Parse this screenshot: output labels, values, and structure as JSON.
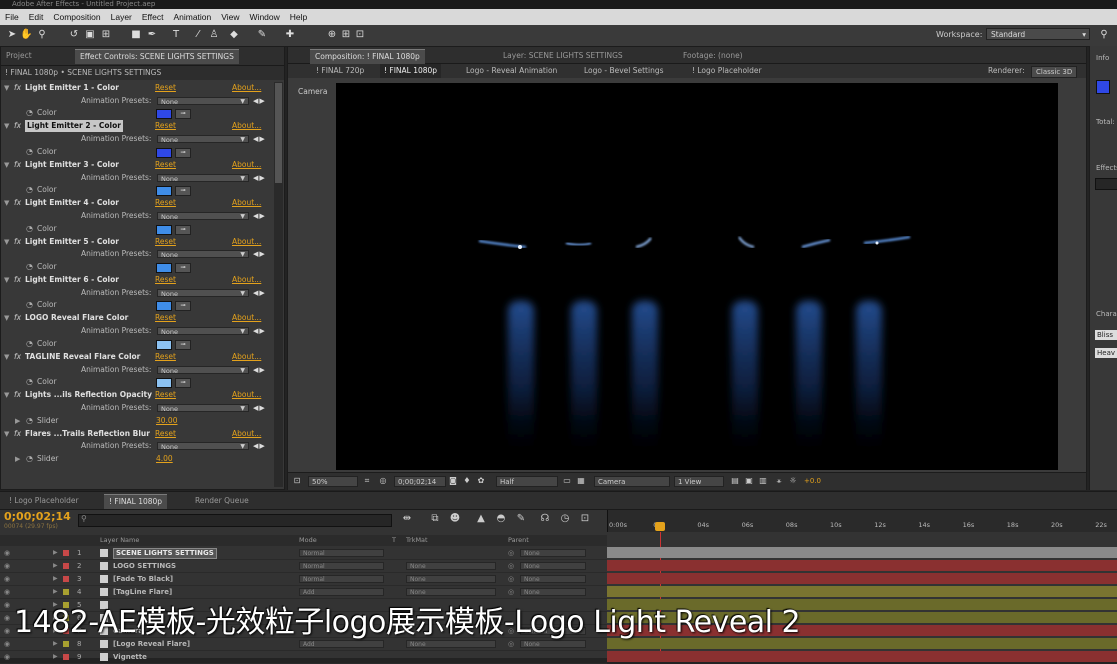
{
  "titlebar": {
    "text": "Adobe After Effects - Untitled Project.aep"
  },
  "menu": [
    "File",
    "Edit",
    "Composition",
    "Layer",
    "Effect",
    "Animation",
    "View",
    "Window",
    "Help"
  ],
  "toolbar": {
    "workspace_label": "Workspace:",
    "workspace_value": "Standard"
  },
  "effect_panel": {
    "tabs": [
      "Project",
      "Effect Controls: SCENE LIGHTS SETTINGS"
    ],
    "breadcrumb": "! FINAL 1080p • SCENE LIGHTS SETTINGS",
    "reset": "Reset",
    "about": "About...",
    "presets_label": "Animation Presets:",
    "presets_value": "None",
    "effects": [
      {
        "name": "Light Emitter 1 - Color",
        "prop": "Color",
        "color": "#2f48e6"
      },
      {
        "name": "Light Emitter 2 - Color",
        "prop": "Color",
        "color": "#2f48e6",
        "selected": true
      },
      {
        "name": "Light Emitter 3 - Color",
        "prop": "Color",
        "color": "#3f8de8"
      },
      {
        "name": "Light Emitter 4 - Color",
        "prop": "Color",
        "color": "#3f8de8"
      },
      {
        "name": "Light Emitter 5 - Color",
        "prop": "Color",
        "color": "#3f8de8"
      },
      {
        "name": "Light Emitter 6 - Color",
        "prop": "Color",
        "color": "#3f8de8"
      },
      {
        "name": "LOGO Reveal Flare Color",
        "prop": "Color",
        "color": "#8cc2f2"
      },
      {
        "name": "TAGLINE Reveal Flare Color",
        "prop": "Color",
        "color": "#8cc2f2"
      },
      {
        "name": "Lights ...ils Reflection Opacity",
        "prop": "Slider",
        "value": "30.00"
      },
      {
        "name": "Flares ...Trails Reflection Blur",
        "prop": "Slider",
        "value": "4.00"
      }
    ]
  },
  "comp_panel": {
    "tabs": [
      "Composition: ! FINAL 1080p",
      "Layer: SCENE LIGHTS SETTINGS",
      "Footage: (none)"
    ],
    "nav": [
      "! FINAL 720p",
      "! FINAL 1080p",
      "Logo - Reveal Animation",
      "Logo - Bevel Settings",
      "! Logo Placeholder"
    ],
    "renderer_label": "Renderer:",
    "renderer_value": "Classic 3D",
    "view_label": "Camera",
    "bottom": {
      "zoom": "50%",
      "timecode": "0;00;02;14",
      "resolution": "Half",
      "camera": "Camera",
      "views": "1 View",
      "exposure": "+0.0"
    }
  },
  "right_panel": {
    "info": "Info",
    "total": "Total:",
    "effects": "Effects",
    "character": "Chara",
    "font": "Bliss",
    "style": "Heav"
  },
  "timeline": {
    "tabs": [
      "! Logo Placeholder",
      "! FINAL 1080p",
      "Render Queue"
    ],
    "timecode": "0;00;02;14",
    "fps": "00074 (29.97 fps)",
    "ruler": [
      "0:00s",
      "02s",
      "04s",
      "06s",
      "08s",
      "10s",
      "12s",
      "14s",
      "16s",
      "18s",
      "20s",
      "22s"
    ],
    "columns": {
      "name": "Layer Name",
      "mode": "Mode",
      "t": "T",
      "trkmat": "TrkMat",
      "parent": "Parent"
    },
    "layers": [
      {
        "num": "1",
        "name": "SCENE LIGHTS SETTINGS",
        "mode": "Normal",
        "trk": "",
        "parent": "None",
        "label": "#c74848",
        "selected": true
      },
      {
        "num": "2",
        "name": "LOGO SETTINGS",
        "mode": "Normal",
        "trk": "None",
        "parent": "None",
        "label": "#c74848"
      },
      {
        "num": "3",
        "name": "[Fade To Black]",
        "mode": "Normal",
        "trk": "None",
        "parent": "None",
        "label": "#c74848"
      },
      {
        "num": "4",
        "name": "[TagLine Flare]",
        "mode": "Add",
        "trk": "None",
        "parent": "None",
        "label": "#a8a030"
      },
      {
        "num": "5",
        "name": "",
        "mode": "",
        "trk": "",
        "parent": "",
        "label": "#a8a030"
      },
      {
        "num": "6",
        "name": "",
        "mode": "",
        "trk": "",
        "parent": "",
        "label": "#a8a030"
      },
      {
        "num": "7",
        "name": "Camera",
        "mode": "",
        "trk": "",
        "parent": "Camera",
        "label": "#c74848"
      },
      {
        "num": "8",
        "name": "[Logo Reveal Flare]",
        "mode": "Add",
        "trk": "None",
        "parent": "None",
        "label": "#a8a030"
      },
      {
        "num": "9",
        "name": "Vignette",
        "mode": "",
        "trk": "",
        "parent": "",
        "label": "#c74848"
      }
    ]
  },
  "watermark": "1482-AE模板-光效粒子logo展示模板-Logo Light Reveal 2"
}
